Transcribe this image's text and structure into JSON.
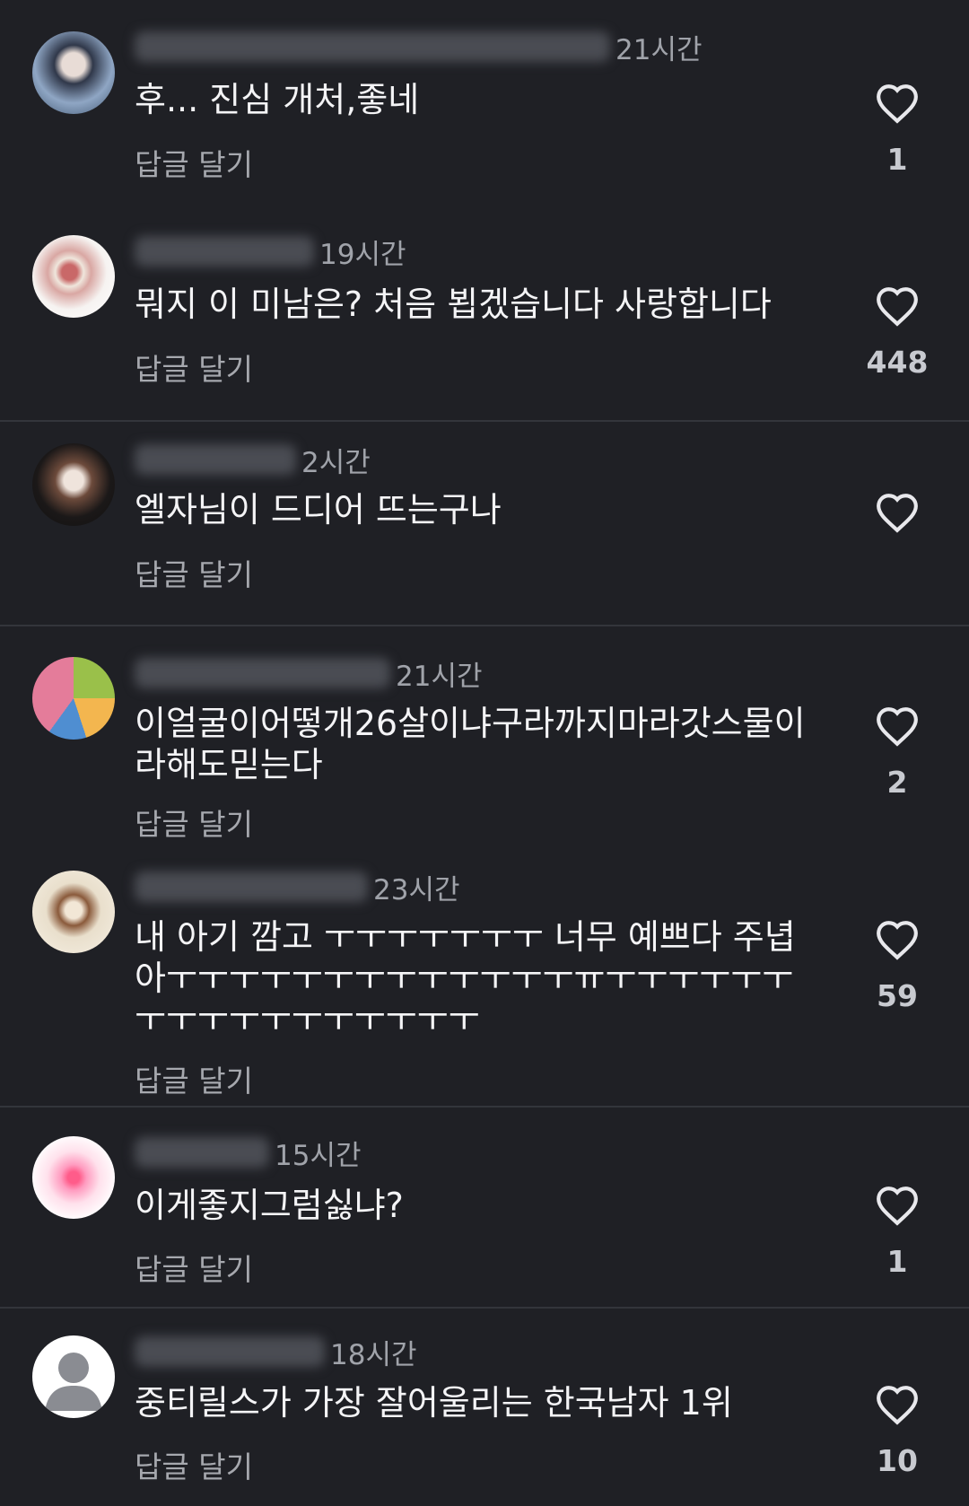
{
  "reply_label": "답글 달기",
  "colors": {
    "background": "#1f2025",
    "divider": "#33353b",
    "muted_text": "#a0a3aa"
  },
  "comments": [
    {
      "time": "21시간",
      "text": "후... 진심 개처,좋네",
      "likes": "1",
      "avatar": "portrait-blue"
    },
    {
      "time": "19시간",
      "text": "뭐지 이 미남은? 처음 뵙겠습니다 사랑합니다",
      "likes": "448",
      "avatar": "flowers-white"
    },
    {
      "time": "2시간",
      "text": "엘자님이 드디어 뜨는구나",
      "likes": "",
      "avatar": "portrait-dark"
    },
    {
      "time": "21시간",
      "text": "이얼굴이어떻개26살이냐구라까지마라갓스물이라해도믿는다",
      "likes": "2",
      "avatar": "illustration-colorful"
    },
    {
      "time": "23시간",
      "text": "내 아기 깜고 ㅜㅜㅜㅜㅜㅜㅜ 너무 예쁘다 주녑아ㅜㅜㅜㅜㅜㅜㅜㅜㅜㅜㅜㅜㅜㅠㅜㅜㅜㅜㅜㅜㅜㅜㅜㅜㅜㅜㅜㅜㅜㅜㅜ",
      "likes": "59",
      "avatar": "character-cream"
    },
    {
      "time": "15시간",
      "text": "이게좋지그럼싫냐?",
      "likes": "1",
      "avatar": "pink-glow"
    },
    {
      "time": "18시간",
      "text": "중티릴스가 가장 잘어울리는 한국남자 1위",
      "likes": "10",
      "avatar": "default-person"
    }
  ]
}
